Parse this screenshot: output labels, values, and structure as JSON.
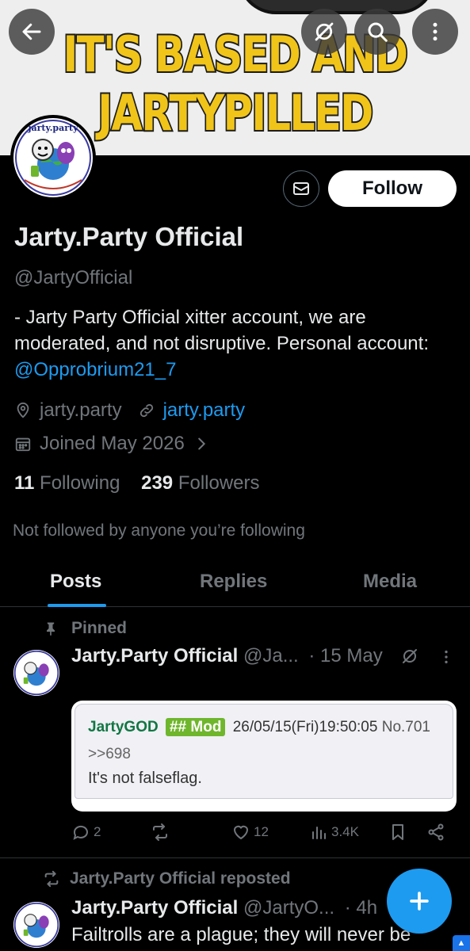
{
  "banner": {
    "line1": "IT'S BASED AND",
    "line2": "JARTYPILLED"
  },
  "header": {
    "back_icon": "arrow-left-icon",
    "grok_icon": "grok-icon",
    "search_icon": "search-icon",
    "more_icon": "more-vertical-icon"
  },
  "profile": {
    "avatar_text": "jarty.party",
    "message_icon": "envelope-icon",
    "follow_label": "Follow",
    "display_name": "Jarty.Party Official",
    "handle": "@JartyOfficial",
    "bio_text": "- Jarty Party Official xitter account, we are moderated, and not disruptive.  Personal account: ",
    "bio_mention": "@Opprobrium21_7",
    "location": "jarty.party",
    "website": "jarty.party",
    "joined": "Joined May 2026",
    "following_count": "11",
    "following_label": "Following",
    "followers_count": "239",
    "followers_label": "Followers",
    "not_followed_text": "Not followed by anyone you’re following"
  },
  "tabs": [
    {
      "label": "Posts",
      "active": true
    },
    {
      "label": "Replies",
      "active": false
    },
    {
      "label": "Media",
      "active": false
    }
  ],
  "posts": [
    {
      "label": "Pinned",
      "author": "Jarty.Party Official",
      "handle": "@Ja...",
      "time": "· 15 May",
      "quote": {
        "name": "JartyGOD",
        "mod": "## Mod",
        "datetime": "26/05/15(Fri)19:50:05",
        "number": "No.701",
        "reply_ref": ">>698",
        "text": "It's not falseflag."
      },
      "replies": "2",
      "reposts": "",
      "likes": "12",
      "views": "3.4K"
    },
    {
      "label": "Jarty.Party Official reposted",
      "author": "Jarty.Party Official",
      "handle": "@JartyO...",
      "time": "· 4h",
      "text": "Failtrolls are a plague; they will never be"
    }
  ],
  "colors": {
    "accent": "#1d9bf0",
    "background": "#000000",
    "text": "#e7e9ea",
    "muted": "#71767b",
    "banner_text": "#f0c419"
  },
  "fab_icon": "plus-icon"
}
